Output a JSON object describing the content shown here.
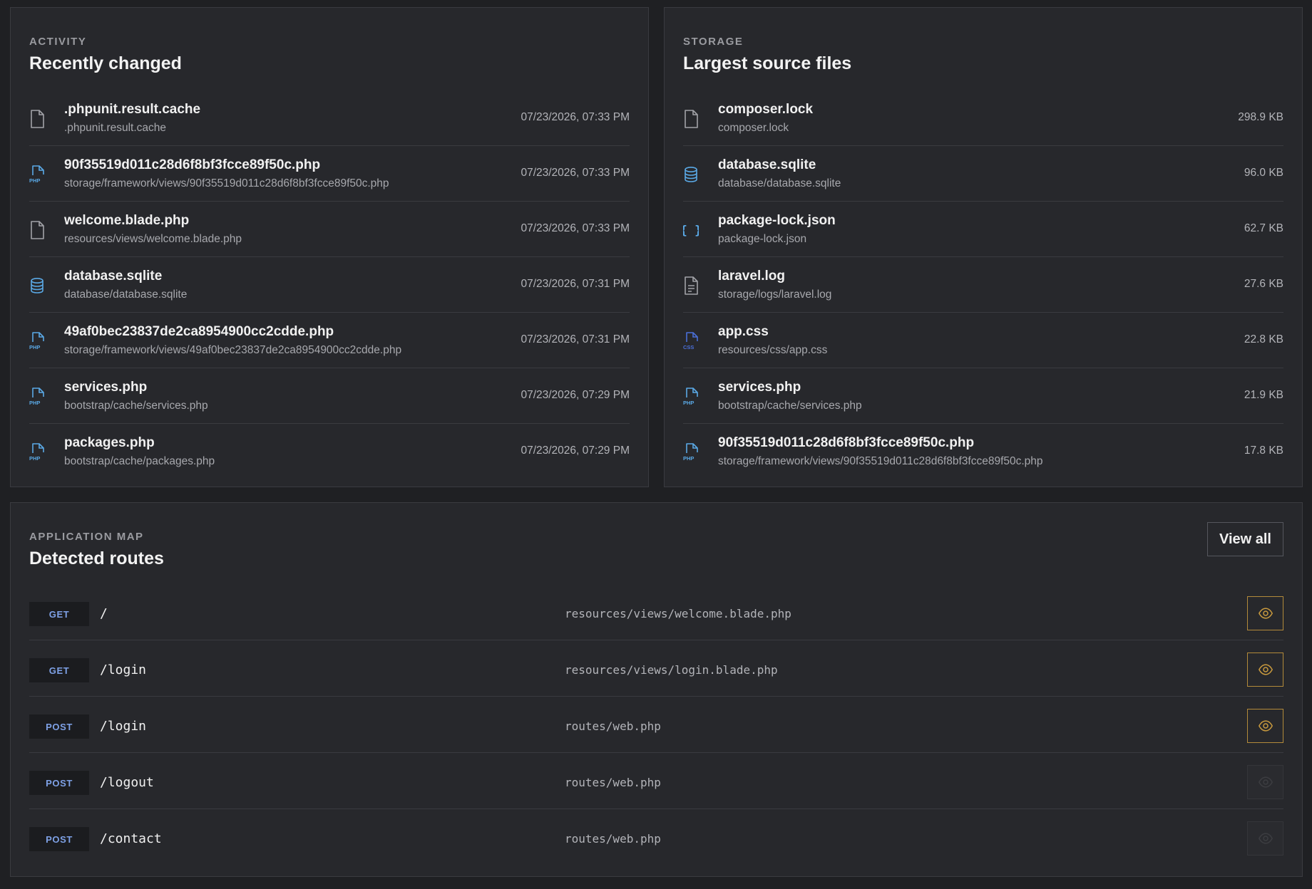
{
  "colors": {
    "background": "#1f2023",
    "panel": "#27282c",
    "method_text": "#7ea1e6",
    "php_icon": "#5aa9e6",
    "css_icon": "#4a6fd8",
    "preview_active": "#c99a3e"
  },
  "activity": {
    "eyebrow": "ACTIVITY",
    "title": "Recently changed",
    "items": [
      {
        "name": ".phpunit.result.cache",
        "path": ".phpunit.result.cache",
        "time": "07/23/2026, 07:33 PM",
        "icon": "file-icon"
      },
      {
        "name": "90f35519d011c28d6f8bf3fcce89f50c.php",
        "path": "storage/framework/views/90f35519d011c28d6f8bf3fcce89f50c.php",
        "time": "07/23/2026, 07:33 PM",
        "icon": "php-file-icon"
      },
      {
        "name": "welcome.blade.php",
        "path": "resources/views/welcome.blade.php",
        "time": "07/23/2026, 07:33 PM",
        "icon": "file-icon"
      },
      {
        "name": "database.sqlite",
        "path": "database/database.sqlite",
        "time": "07/23/2026, 07:31 PM",
        "icon": "database-icon"
      },
      {
        "name": "49af0bec23837de2ca8954900cc2cdde.php",
        "path": "storage/framework/views/49af0bec23837de2ca8954900cc2cdde.php",
        "time": "07/23/2026, 07:31 PM",
        "icon": "php-file-icon"
      },
      {
        "name": "services.php",
        "path": "bootstrap/cache/services.php",
        "time": "07/23/2026, 07:29 PM",
        "icon": "php-file-icon"
      },
      {
        "name": "packages.php",
        "path": "bootstrap/cache/packages.php",
        "time": "07/23/2026, 07:29 PM",
        "icon": "php-file-icon"
      }
    ]
  },
  "storage": {
    "eyebrow": "STORAGE",
    "title": "Largest source files",
    "items": [
      {
        "name": "composer.lock",
        "path": "composer.lock",
        "size": "298.9 KB",
        "icon": "file-icon"
      },
      {
        "name": "database.sqlite",
        "path": "database/database.sqlite",
        "size": "96.0 KB",
        "icon": "database-icon"
      },
      {
        "name": "package-lock.json",
        "path": "package-lock.json",
        "size": "62.7 KB",
        "icon": "json-braces-icon"
      },
      {
        "name": "laravel.log",
        "path": "storage/logs/laravel.log",
        "size": "27.6 KB",
        "icon": "text-file-icon"
      },
      {
        "name": "app.css",
        "path": "resources/css/app.css",
        "size": "22.8 KB",
        "icon": "css-file-icon"
      },
      {
        "name": "services.php",
        "path": "bootstrap/cache/services.php",
        "size": "21.9 KB",
        "icon": "php-file-icon"
      },
      {
        "name": "90f35519d011c28d6f8bf3fcce89f50c.php",
        "path": "storage/framework/views/90f35519d011c28d6f8bf3fcce89f50c.php",
        "size": "17.8 KB",
        "icon": "php-file-icon"
      }
    ]
  },
  "routes": {
    "eyebrow": "APPLICATION MAP",
    "title": "Detected routes",
    "view_all_label": "View all",
    "items": [
      {
        "method": "GET",
        "path": "/",
        "file": "resources/views/welcome.blade.php",
        "preview_enabled": true
      },
      {
        "method": "GET",
        "path": "/login",
        "file": "resources/views/login.blade.php",
        "preview_enabled": true
      },
      {
        "method": "POST",
        "path": "/login",
        "file": "routes/web.php",
        "preview_enabled": true
      },
      {
        "method": "POST",
        "path": "/logout",
        "file": "routes/web.php",
        "preview_enabled": false
      },
      {
        "method": "POST",
        "path": "/contact",
        "file": "routes/web.php",
        "preview_enabled": false
      }
    ]
  },
  "icons": {
    "php_label": "PHP",
    "css_label": "CSS",
    "json_label": "{ }"
  }
}
